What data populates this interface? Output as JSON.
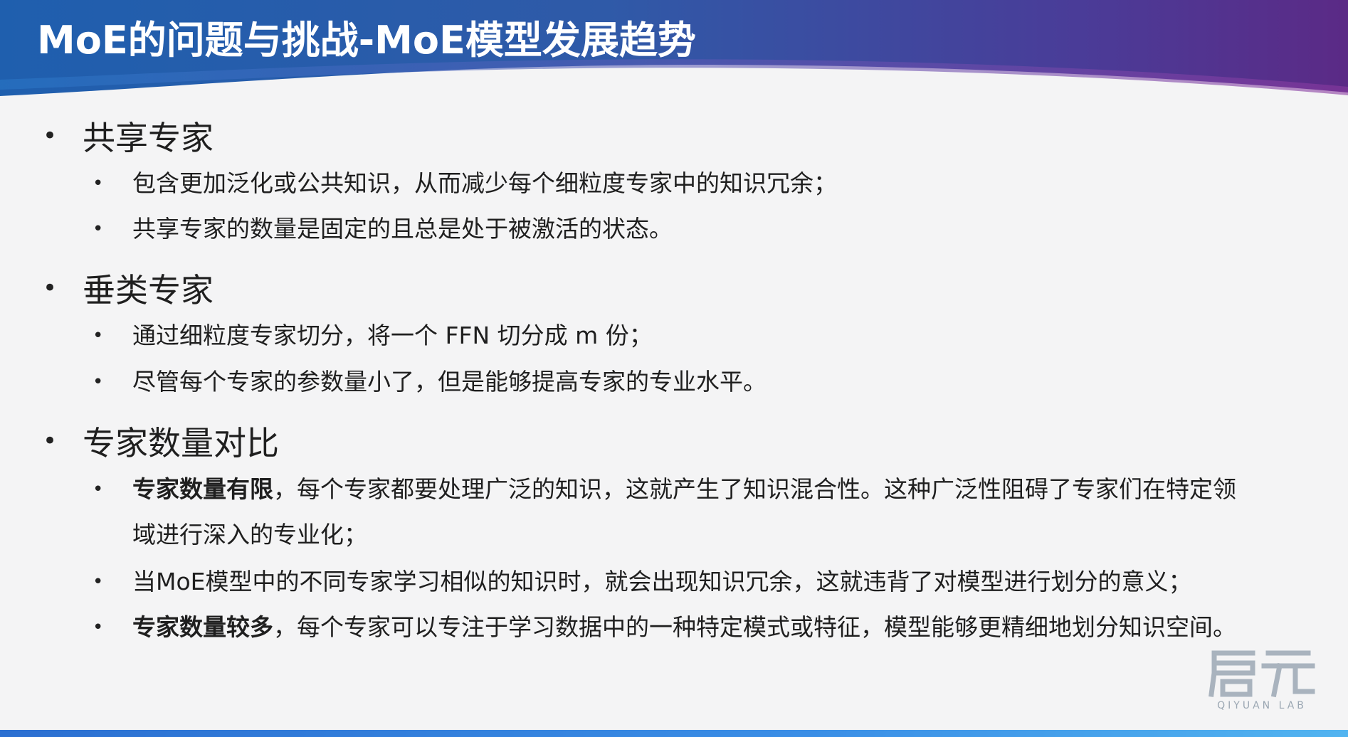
{
  "slide": {
    "title": "MoE的问题与挑战-MoE模型发展趋势"
  },
  "colors": {
    "header_left": "#1f5fae",
    "header_right": "#5b2a86",
    "text": "#1f1f1f",
    "bottom_bar": "#2b6fd1"
  },
  "sections": [
    {
      "heading": "共享专家",
      "items": [
        {
          "bold": "",
          "text": "包含更加泛化或公共知识，从而减少每个细粒度专家中的知识冗余；"
        },
        {
          "bold": "",
          "text": "共享专家的数量是固定的且总是处于被激活的状态。"
        }
      ]
    },
    {
      "heading": "垂类专家",
      "items": [
        {
          "bold": "",
          "text": "通过细粒度专家切分，将一个 FFN 切分成 m 份；"
        },
        {
          "bold": "",
          "text": "尽管每个专家的参数量小了，但是能够提高专家的专业水平。"
        }
      ]
    },
    {
      "heading": "专家数量对比",
      "items": [
        {
          "bold": "专家数量有限",
          "text": "，每个专家都要处理广泛的知识，这就产生了知识混合性。这种广泛性阻碍了专家们在特定领域进行深入的专业化；"
        },
        {
          "bold": "",
          "text": "当MoE模型中的不同专家学习相似的知识时，就会出现知识冗余，这就违背了对模型进行划分的意义；"
        },
        {
          "bold": "专家数量较多",
          "text": "，每个专家可以专注于学习数据中的一种特定模式或特征，模型能够更精细地划分知识空间。"
        }
      ]
    }
  ],
  "bullets": {
    "major": "•",
    "minor": "•"
  },
  "logo": {
    "mark": "启元",
    "subtitle": "QIYUAN LAB",
    "icon": "qiyuan-logo-icon"
  }
}
